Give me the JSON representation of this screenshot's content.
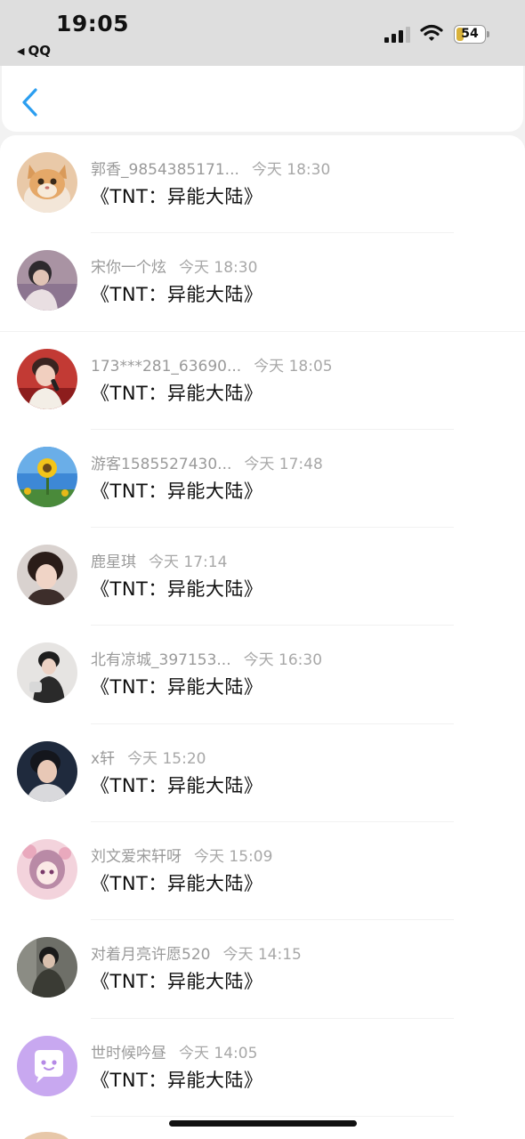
{
  "status_bar": {
    "time": "19:05",
    "back_app": "QQ",
    "battery_level": "54",
    "icons": [
      "signal-icon",
      "wifi-icon",
      "battery-icon"
    ]
  },
  "header": {
    "back_icon": "chevron-left-icon",
    "accent": "#2b9ef0"
  },
  "messages": [
    {
      "name": "郭香_9854385171...",
      "time": "今天 18:30",
      "text": "《TNT：异能大陆》",
      "avatar": "kitten-avatar"
    },
    {
      "name": "宋你一个炫",
      "time": "今天 18:30",
      "text": "《TNT：异能大陆》",
      "avatar": "person-avatar"
    },
    {
      "name": "173***281_63690...",
      "time": "今天 18:05",
      "text": "《TNT：异能大陆》",
      "avatar": "singer-avatar"
    },
    {
      "name": "游客1585527430...",
      "time": "今天 17:48",
      "text": "《TNT：异能大陆》",
      "avatar": "sunflower-avatar"
    },
    {
      "name": "鹿星琪",
      "time": "今天 17:14",
      "text": "《TNT：异能大陆》",
      "avatar": "person-avatar"
    },
    {
      "name": "北有凉城_397153...",
      "time": "今天 16:30",
      "text": "《TNT：异能大陆》",
      "avatar": "person-avatar"
    },
    {
      "name": "x轩",
      "time": "今天 15:20",
      "text": "《TNT：异能大陆》",
      "avatar": "person-avatar"
    },
    {
      "name": "刘文爱宋轩呀",
      "time": "今天 15:09",
      "text": "《TNT：异能大陆》",
      "avatar": "anime-avatar"
    },
    {
      "name": "对着月亮许愿520",
      "time": "今天 14:15",
      "text": "《TNT：异能大陆》",
      "avatar": "person-avatar"
    },
    {
      "name": "世时候吟昼",
      "time": "今天 14:05",
      "text": "《TNT：异能大陆》",
      "avatar": "default-chat-avatar"
    }
  ]
}
